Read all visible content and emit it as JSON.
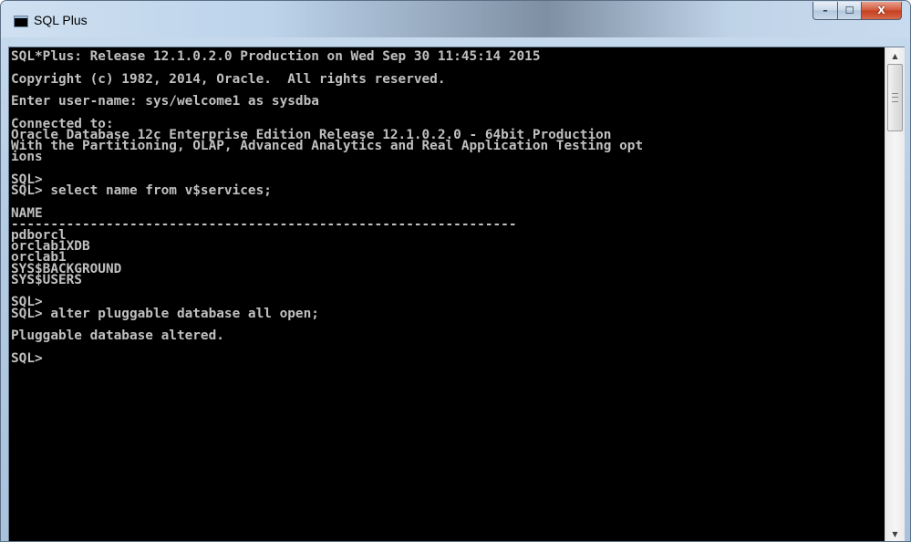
{
  "window": {
    "title": "SQL Plus",
    "buttons": {
      "minimize": "–",
      "maximize": "☐",
      "close": "X"
    }
  },
  "console": {
    "lines": [
      "SQL*Plus: Release 12.1.0.2.0 Production on Wed Sep 30 11:45:14 2015",
      "",
      "Copyright (c) 1982, 2014, Oracle.  All rights reserved.",
      "",
      "Enter user-name: sys/welcome1 as sysdba",
      "",
      "Connected to:",
      "Oracle Database 12c Enterprise Edition Release 12.1.0.2.0 - 64bit Production",
      "With the Partitioning, OLAP, Advanced Analytics and Real Application Testing opt",
      "ions",
      "",
      "SQL>",
      "SQL> select name from v$services;",
      "",
      "NAME",
      "----------------------------------------------------------------",
      "pdborcl",
      "orclab1XDB",
      "orclab1",
      "SYS$BACKGROUND",
      "SYS$USERS",
      "",
      "SQL>",
      "SQL> alter pluggable database all open;",
      "",
      "Pluggable database altered.",
      "",
      "SQL>"
    ]
  }
}
